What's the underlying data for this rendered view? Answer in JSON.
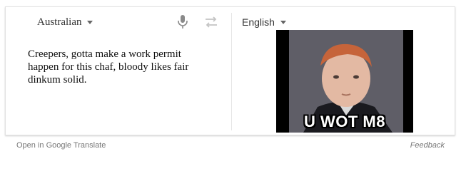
{
  "source": {
    "language": "Australian",
    "text": "Creepers, gotta make a work permit happen for this chaf, bloody likes fair dinkum solid."
  },
  "target": {
    "language": "English",
    "image_caption": "U WOT M8"
  },
  "icons": {
    "microphone": "microphone-icon",
    "swap": "swap-languages-icon",
    "dropdown": "chevron-down-icon"
  },
  "footer": {
    "open_link": "Open in Google Translate",
    "feedback": "Feedback"
  }
}
